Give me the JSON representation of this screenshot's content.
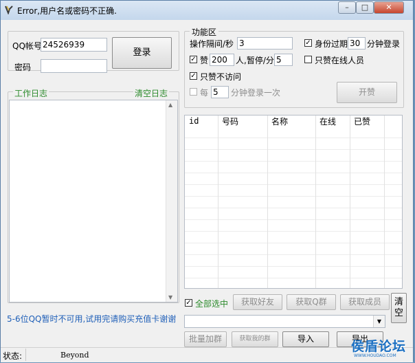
{
  "window": {
    "title": "Error,用户名或密码不正确.",
    "min": "–",
    "max": "□",
    "close": "✕"
  },
  "login": {
    "qq_label": "QQ帐号",
    "qq_value": "24526939",
    "pwd_label": "密码",
    "pwd_value": "",
    "login_button": "登录"
  },
  "log": {
    "title": "工作日志",
    "clear_label": "清空日志",
    "notice": "5-6位QQ暂时不可用,试用完请购买充值卡谢谢"
  },
  "funcs": {
    "title": "功能区",
    "interval_label": "操作隔间/秒",
    "interval_value": "3",
    "identity_label": "身份过期",
    "identity_value": "30",
    "identity_suffix": "分钟登录",
    "identity_checked": true,
    "like_label": "赞",
    "like_value": "200",
    "pause_label": "人,暂停/分",
    "pause_value": "5",
    "like_checked": true,
    "online_only_label": "只赞在线人员",
    "online_only_checked": false,
    "no_visit_label": "只赞不访问",
    "no_visit_checked": true,
    "every_label": "每",
    "every_value": "5",
    "every_suffix": "分钟登录一次",
    "every_checked": false,
    "start_button": "开赞"
  },
  "table": {
    "columns": [
      "id",
      "号码",
      "名称",
      "在线",
      "已赞"
    ]
  },
  "actions": {
    "select_all_label": "全部选中",
    "select_all_checked": true,
    "get_friends": "获取好友",
    "get_groups": "获取Q群",
    "get_members": "获取成员",
    "clear": "清空",
    "dropdown_value": "",
    "batch_join": "批量加群",
    "get_my_groups": "获取我的群",
    "import": "导入",
    "export": "导出"
  },
  "status": {
    "label": "状态:",
    "value": "Beyond"
  },
  "watermark": {
    "text": "侯盾论坛",
    "sub": "WWW.HOUDAO.COM"
  }
}
